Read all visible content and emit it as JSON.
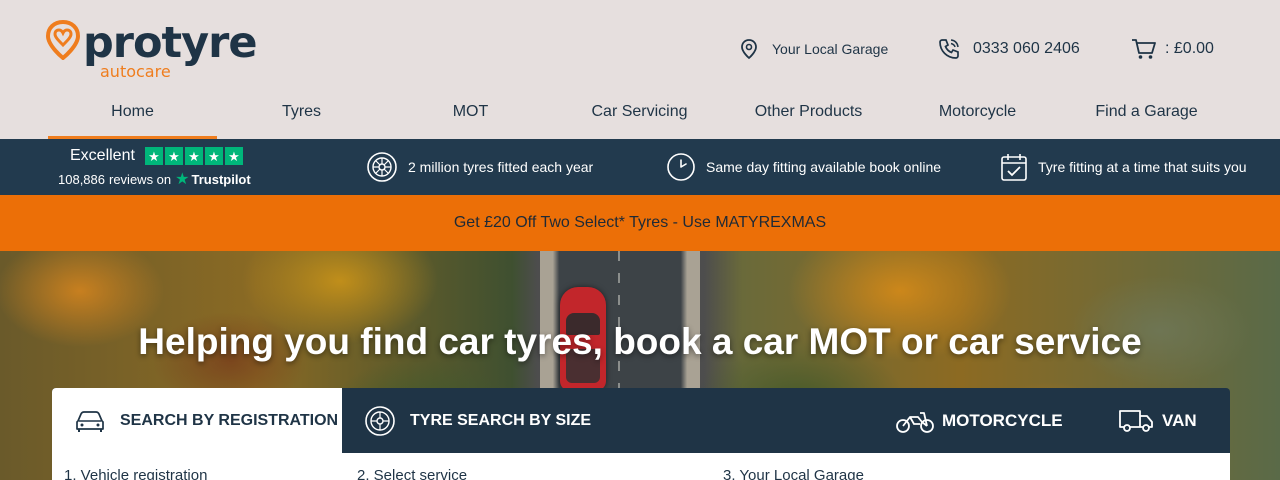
{
  "brand": {
    "name": "protyre",
    "sub": "autocare",
    "primary_color": "#1f3446",
    "accent_color": "#ef7d1e"
  },
  "header": {
    "garage_label": "Your Local Garage",
    "phone": "0333 060 2406",
    "cart_label": ": £0.00"
  },
  "nav": {
    "items": [
      {
        "label": "Home",
        "active": true
      },
      {
        "label": "Tyres"
      },
      {
        "label": "MOT"
      },
      {
        "label": "Car Servicing"
      },
      {
        "label": "Other Products"
      },
      {
        "label": "Motorcycle"
      },
      {
        "label": "Find a Garage"
      }
    ]
  },
  "trust": {
    "rating_label": "Excellent",
    "reviews_count": "108,886",
    "reviews_on": "reviews on",
    "provider": "Trustpilot",
    "usps": [
      {
        "icon": "tyre-icon",
        "text": "2 million tyres fitted each year"
      },
      {
        "icon": "clock-icon",
        "text": "Same day fitting available book online"
      },
      {
        "icon": "calendar-check-icon",
        "text": "Tyre fitting at a time that suits you"
      }
    ]
  },
  "promo": {
    "text": "Get £20 Off Two Select* Tyres - Use MATYREXMAS",
    "color": "#ec6f07"
  },
  "hero": {
    "title": "Helping you find car tyres, book a car MOT or car service"
  },
  "search": {
    "tabs": {
      "registration": "SEARCH BY REGISTRATION",
      "size": "TYRE SEARCH BY SIZE",
      "motorcycle": "MOTORCYCLE",
      "van": "VAN"
    },
    "steps": {
      "s1": "1. Vehicle registration",
      "s2": "2. Select service",
      "s3": "3. Your Local Garage"
    }
  }
}
